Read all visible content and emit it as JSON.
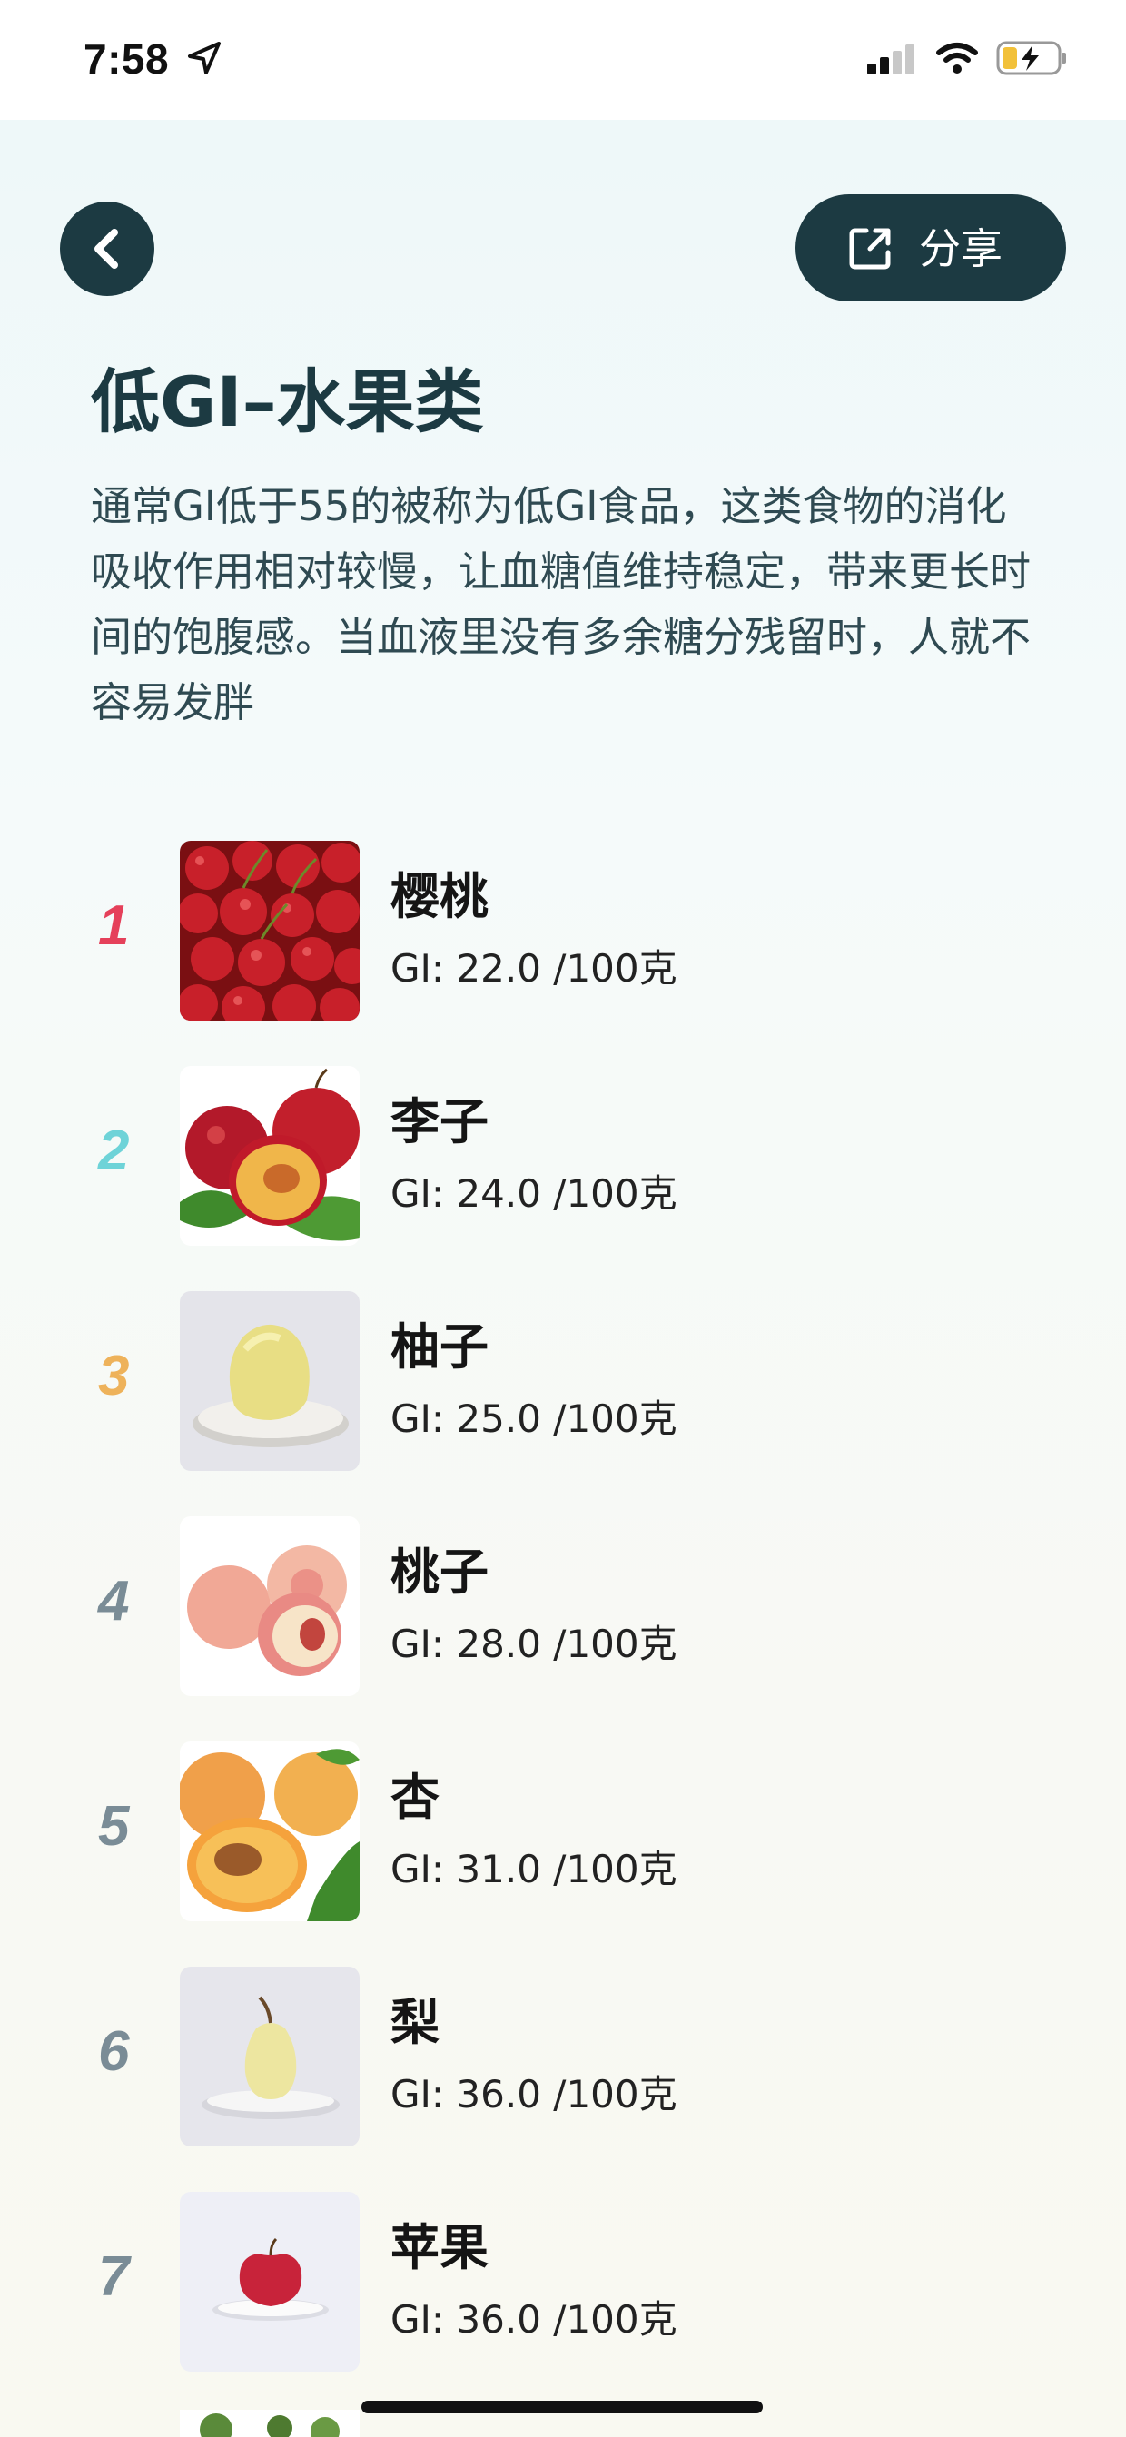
{
  "status_bar": {
    "time": "7:58",
    "icons": [
      "location-arrow-icon",
      "signal-icon",
      "wifi-icon",
      "battery-charging-icon"
    ]
  },
  "header": {
    "back_icon": "chevron-left-icon",
    "share_icon": "external-link-icon",
    "share_label": "分享"
  },
  "page": {
    "title": "低GI–水果类",
    "description": "通常GI低于55的被称为低GI食品，这类食物的消化吸收作用相对较慢，让血糖值维持稳定，带来更长时间的饱腹感。当血液里没有多余糖分残留时，人就不容易发胖"
  },
  "colors": {
    "accent_dark": "#1c3a42",
    "rank_1": "#e5405a",
    "rank_2": "#6ed3d8",
    "rank_3": "#eeb25a",
    "rank_default": "#7a8c96"
  },
  "items": [
    {
      "rank": "1",
      "name": "樱桃",
      "gi": "GI: 22.0 /100克",
      "image": "cherries"
    },
    {
      "rank": "2",
      "name": "李子",
      "gi": "GI: 24.0 /100克",
      "image": "plums"
    },
    {
      "rank": "3",
      "name": "柚子",
      "gi": "GI: 25.0 /100克",
      "image": "pomelo"
    },
    {
      "rank": "4",
      "name": "桃子",
      "gi": "GI: 28.0 /100克",
      "image": "peaches"
    },
    {
      "rank": "5",
      "name": "杏",
      "gi": "GI: 31.0 /100克",
      "image": "apricots"
    },
    {
      "rank": "6",
      "name": "梨",
      "gi": "GI: 36.0 /100克",
      "image": "pear"
    },
    {
      "rank": "7",
      "name": "苹果",
      "gi": "GI: 36.0 /100克",
      "image": "apple"
    }
  ]
}
